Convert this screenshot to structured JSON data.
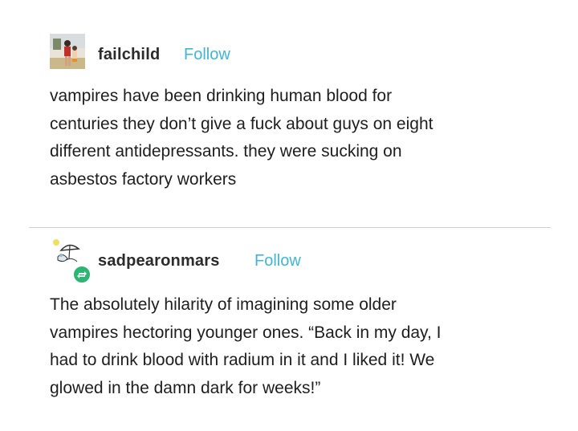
{
  "posts": [
    {
      "username": "failchild",
      "follow_label": "Follow",
      "avatar_icon": "person-on-beach-avatar",
      "lines": [
        "vampires have been drinking human blood for",
        "centuries they don’t give a fuck about guys on eight",
        "different antidepressants. they were sucking on",
        "asbestos factory workers"
      ]
    },
    {
      "username": "sadpearonmars",
      "follow_label": "Follow",
      "avatar_icon": "umbrella-sketch-avatar",
      "reblog_icon": "reblog-icon",
      "lines": [
        "The absolutely hilarity of imagining some older",
        "vampires hectoring younger ones. “Back in my day, I",
        "had to drink blood with radium in it and I liked it! We",
        "glowed in the damn dark for weeks!”"
      ]
    }
  ],
  "colors": {
    "follow": "#3fb6d7",
    "reblog_badge": "#2bb673",
    "divider": "#cfcfcf"
  }
}
